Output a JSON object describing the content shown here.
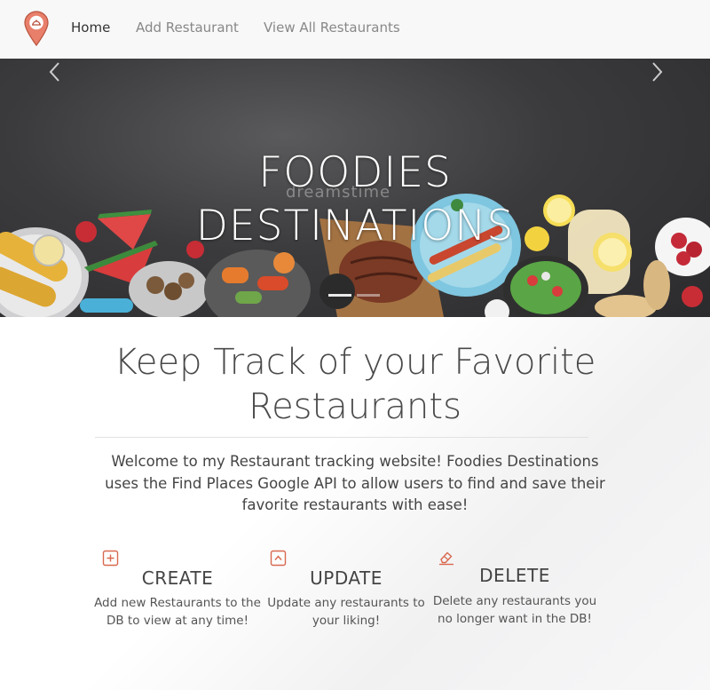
{
  "nav": {
    "items": [
      {
        "label": "Home",
        "active": true
      },
      {
        "label": "Add Restaurant",
        "active": false
      },
      {
        "label": "View All Restaurants",
        "active": false
      }
    ],
    "logo_icon": "map-pin-icon"
  },
  "hero": {
    "title_line1": "FOODIES",
    "title_line2": "DESTINATIONS",
    "watermark": "dreamstime",
    "slide_count": 2,
    "active_slide": 1
  },
  "main": {
    "headline": "Keep Track of your Favorite Restaurants",
    "intro": "Welcome to my Restaurant tracking website! Foodies Destinations uses the Find Places Google API to allow users to find and save their favorite restaurants with ease!",
    "features": [
      {
        "title": "CREATE",
        "description": "Add new Restaurants to the DB to view at any time!",
        "icon": "plus-square-icon"
      },
      {
        "title": "UPDATE",
        "description": "Update any restaurants to your liking!",
        "icon": "caret-up-square-icon"
      },
      {
        "title": "DELETE",
        "description": "Delete any restaurants you no longer want in the DB!",
        "icon": "eraser-icon"
      }
    ]
  },
  "colors": {
    "accent": "#d9694f",
    "navbar_bg": "#f8f8f8",
    "text": "#444444"
  }
}
